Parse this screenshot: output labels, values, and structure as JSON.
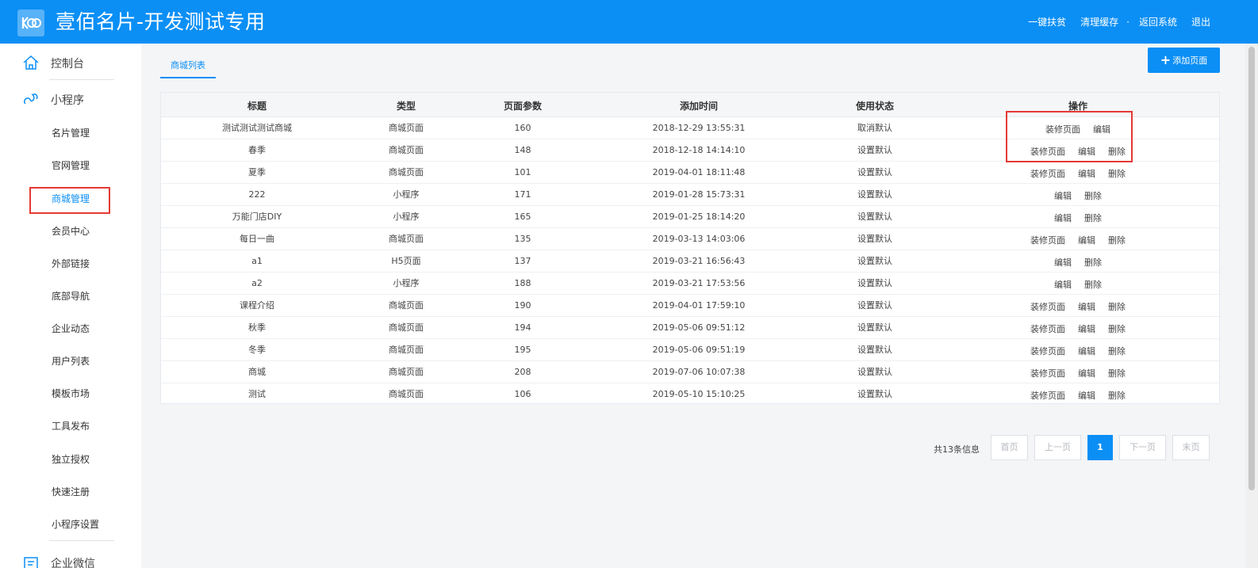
{
  "header": {
    "title": "壹佰名片-开发测试专用",
    "nav": [
      "一键扶贫",
      "清理缓存",
      "·",
      "返回系统",
      "退出"
    ]
  },
  "sidebar": {
    "top1": "控制台",
    "top2": "小程序",
    "items": [
      "名片管理",
      "官网管理",
      "商城管理",
      "会员中心",
      "外部链接",
      "底部导航",
      "企业动态",
      "用户列表",
      "模板市场",
      "工具发布",
      "独立授权",
      "快速注册",
      "小程序设置"
    ],
    "active_index": 2,
    "top3": "企业微信"
  },
  "main": {
    "tab": "商城列表",
    "add_button": "添加页面"
  },
  "table": {
    "headers": [
      "标题",
      "类型",
      "页面参数",
      "添加时间",
      "使用状态",
      "操作"
    ],
    "rows": [
      {
        "title": "测试测试测试商城",
        "type": "商城页面",
        "param": "160",
        "time": "2018-12-29 13:55:31",
        "status": "取消默认",
        "ops": [
          "装修页面",
          "编辑"
        ]
      },
      {
        "title": "春季",
        "type": "商城页面",
        "param": "148",
        "time": "2018-12-18 14:14:10",
        "status": "设置默认",
        "ops": [
          "装修页面",
          "编辑",
          "删除"
        ]
      },
      {
        "title": "夏季",
        "type": "商城页面",
        "param": "101",
        "time": "2019-04-01 18:11:48",
        "status": "设置默认",
        "ops": [
          "装修页面",
          "编辑",
          "删除"
        ]
      },
      {
        "title": "222",
        "type": "小程序",
        "param": "171",
        "time": "2019-01-28 15:73:31",
        "status": "设置默认",
        "ops": [
          "编辑",
          "删除"
        ]
      },
      {
        "title": "万能门店DIY",
        "type": "小程序",
        "param": "165",
        "time": "2019-01-25 18:14:20",
        "status": "设置默认",
        "ops": [
          "编辑",
          "删除"
        ]
      },
      {
        "title": "每日一曲",
        "type": "商城页面",
        "param": "135",
        "time": "2019-03-13 14:03:06",
        "status": "设置默认",
        "ops": [
          "装修页面",
          "编辑",
          "删除"
        ]
      },
      {
        "title": "a1",
        "type": "H5页面",
        "param": "137",
        "time": "2019-03-21 16:56:43",
        "status": "设置默认",
        "ops": [
          "编辑",
          "删除"
        ]
      },
      {
        "title": "a2",
        "type": "小程序",
        "param": "188",
        "time": "2019-03-21 17:53:56",
        "status": "设置默认",
        "ops": [
          "编辑",
          "删除"
        ]
      },
      {
        "title": "课程介绍",
        "type": "商城页面",
        "param": "190",
        "time": "2019-04-01 17:59:10",
        "status": "设置默认",
        "ops": [
          "装修页面",
          "编辑",
          "删除"
        ]
      },
      {
        "title": "秋季",
        "type": "商城页面",
        "param": "194",
        "time": "2019-05-06 09:51:12",
        "status": "设置默认",
        "ops": [
          "装修页面",
          "编辑",
          "删除"
        ]
      },
      {
        "title": "冬季",
        "type": "商城页面",
        "param": "195",
        "time": "2019-05-06 09:51:19",
        "status": "设置默认",
        "ops": [
          "装修页面",
          "编辑",
          "删除"
        ]
      },
      {
        "title": "商城",
        "type": "商城页面",
        "param": "208",
        "time": "2019-07-06 10:07:38",
        "status": "设置默认",
        "ops": [
          "装修页面",
          "编辑",
          "删除"
        ]
      },
      {
        "title": "测试",
        "type": "商城页面",
        "param": "106",
        "time": "2019-05-10 15:10:25",
        "status": "设置默认",
        "ops": [
          "装修页面",
          "编辑",
          "删除"
        ]
      }
    ]
  },
  "pagination": {
    "info": "共13条信息",
    "first": "首页",
    "prev": "上一页",
    "current": "1",
    "next": "下一页",
    "last": "末页"
  },
  "colors": {
    "primary": "#0b8ff5",
    "highlight": "#e53935"
  }
}
